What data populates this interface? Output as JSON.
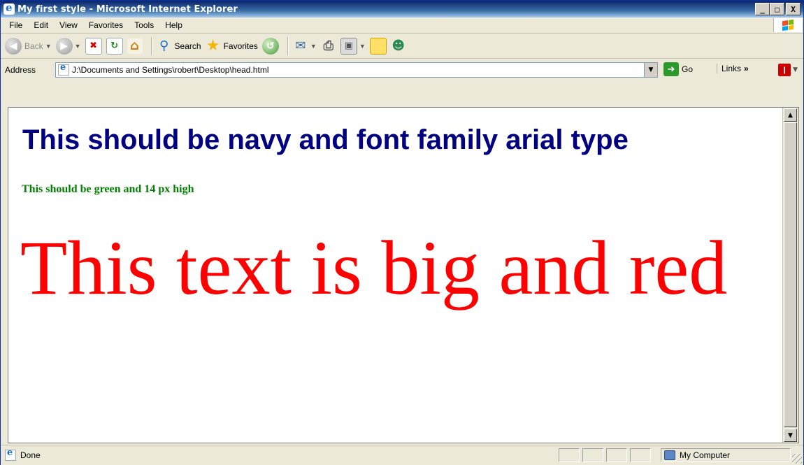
{
  "window": {
    "title": "My first style - Microsoft Internet Explorer",
    "buttons": {
      "minimize": "_",
      "maximize": "□",
      "close": "X"
    }
  },
  "menu": [
    "File",
    "Edit",
    "View",
    "Favorites",
    "Tools",
    "Help"
  ],
  "toolbar": {
    "back_label": "Back",
    "search_label": "Search",
    "favorites_label": "Favorites"
  },
  "address": {
    "label": "Address",
    "value": "J:\\Documents and Settings\\robert\\Desktop\\head.html",
    "go_label": "Go",
    "links_label": "Links"
  },
  "page": {
    "heading": "This should be navy and font family arial type",
    "green_text": "This should be green and 14 px high",
    "big_text": "This text is big and red",
    "colors": {
      "heading": "#000080",
      "green": "#008000",
      "red": "#ff0000"
    }
  },
  "status": {
    "text": "Done",
    "zone": "My Computer"
  }
}
